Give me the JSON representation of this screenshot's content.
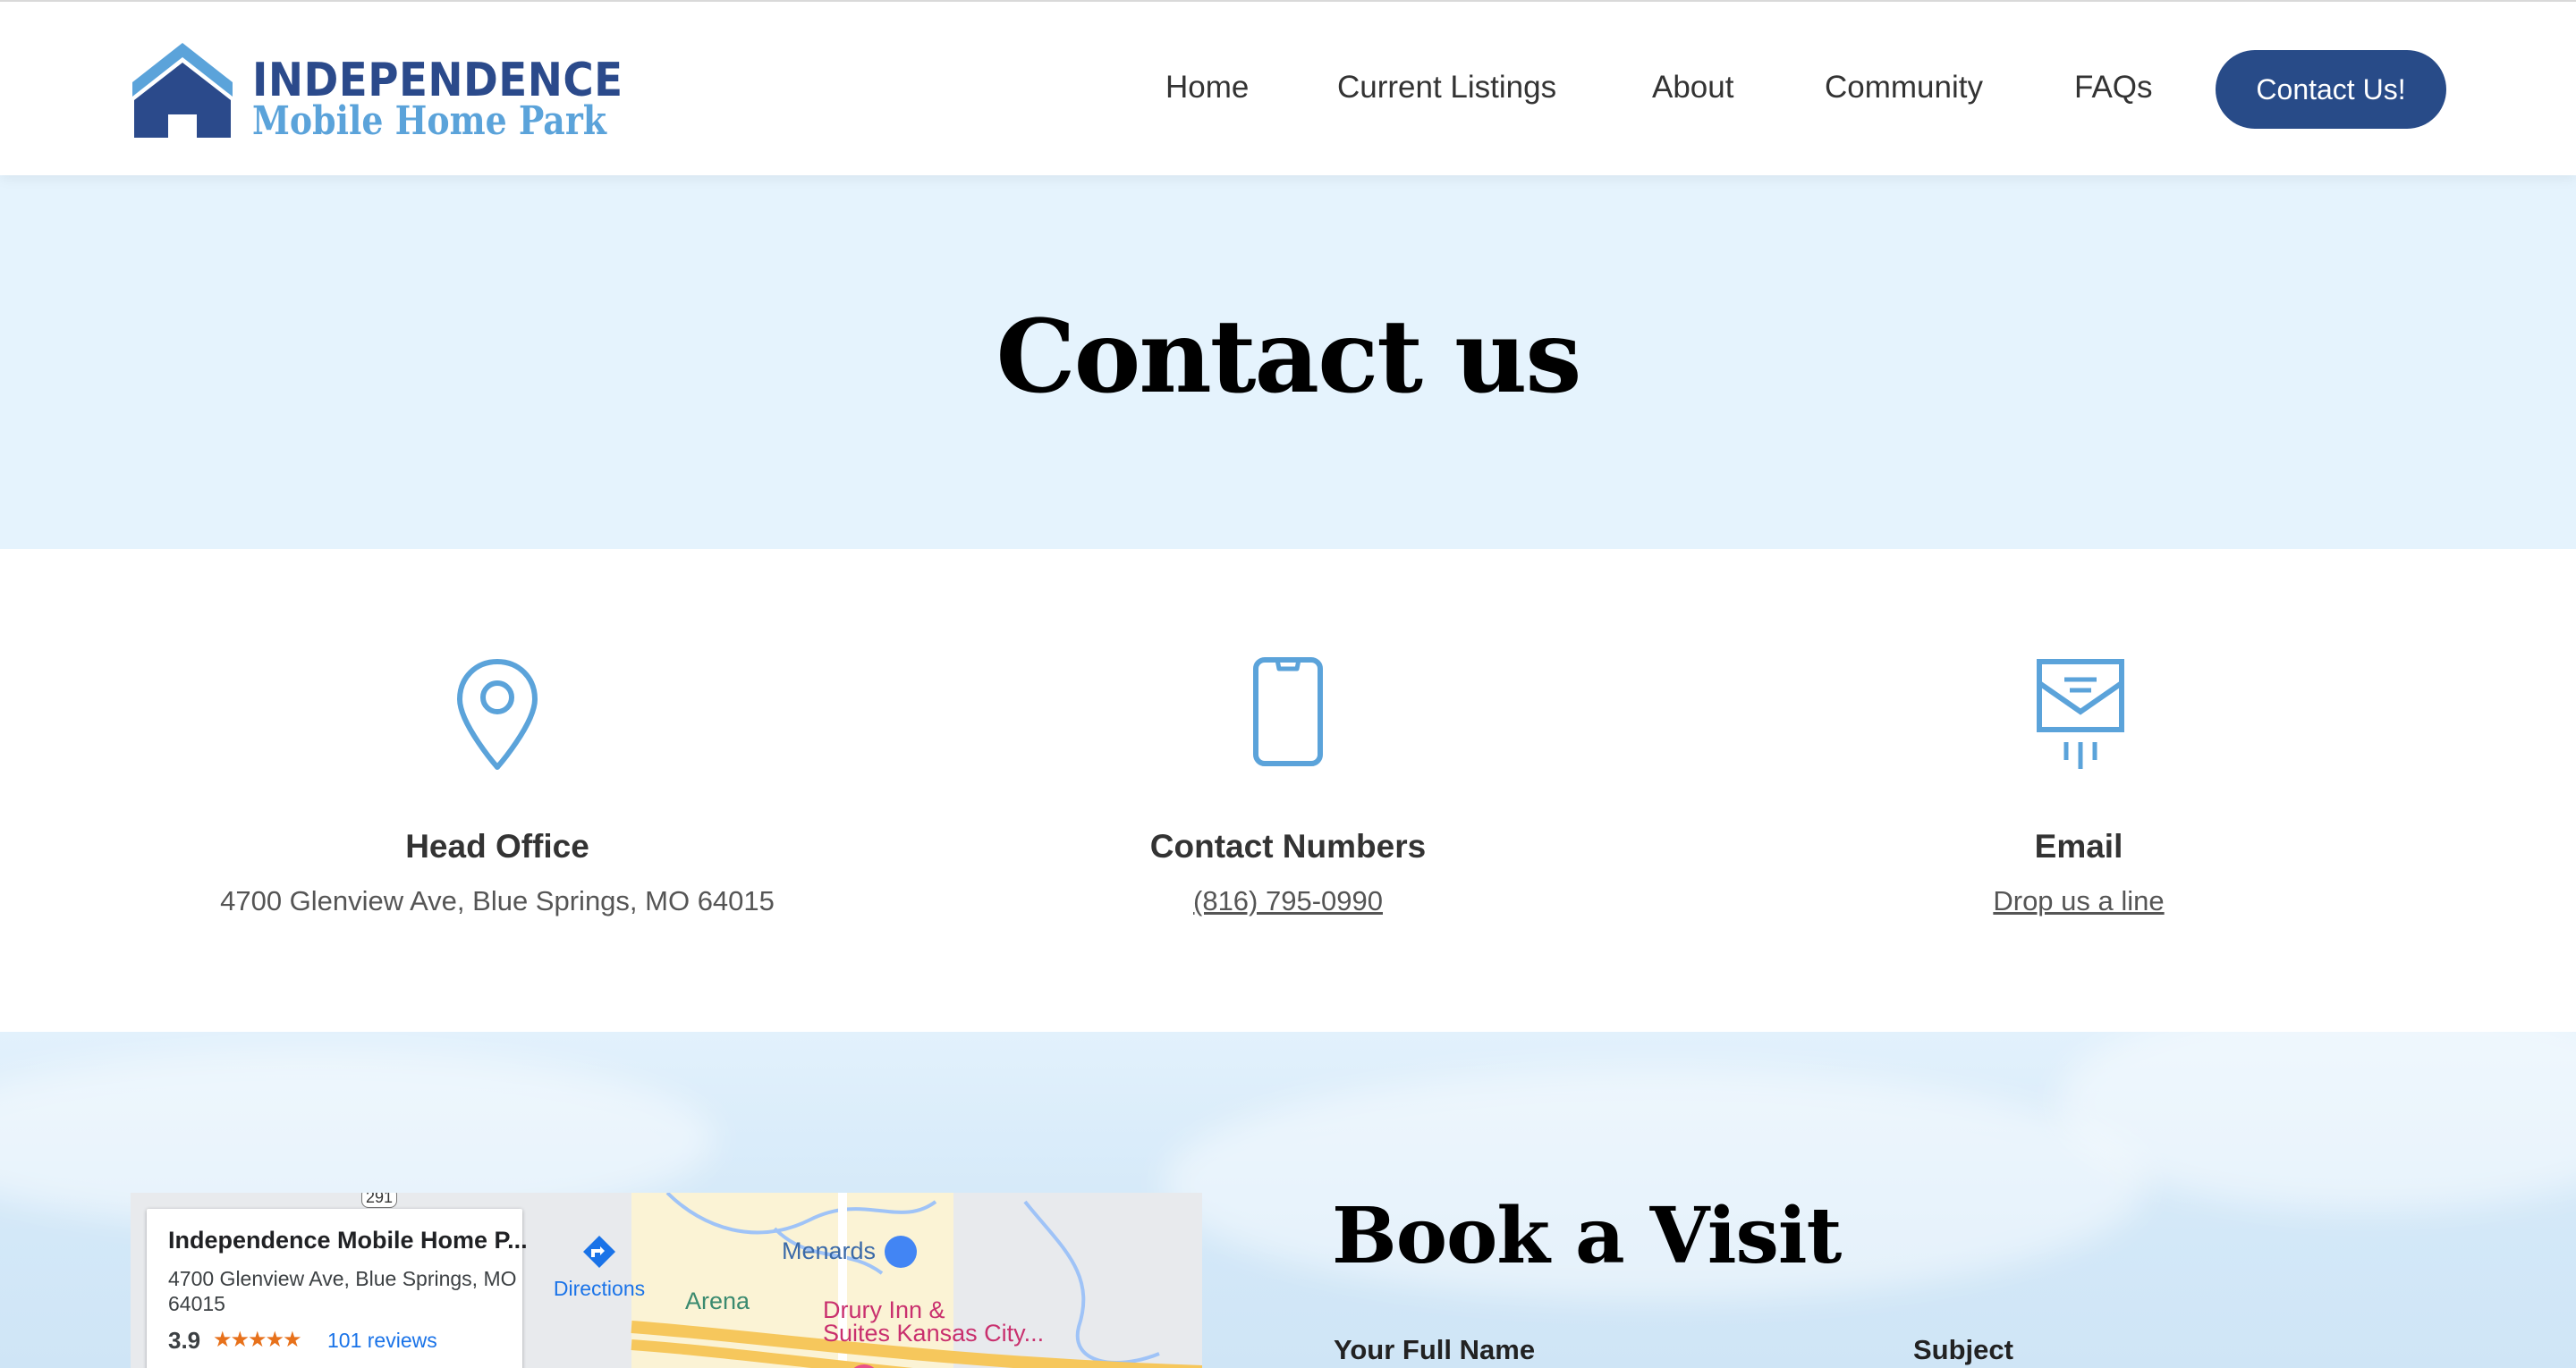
{
  "header": {
    "logo": {
      "line1": "INDEPENDENCE",
      "line2": "Mobile Home Park"
    },
    "nav": [
      "Home",
      "Current Listings",
      "About",
      "Community",
      "FAQs"
    ],
    "cta": "Contact Us!"
  },
  "hero": {
    "title": "Contact us"
  },
  "info": [
    {
      "icon": "location-pin-icon",
      "title": "Head Office",
      "text": "4700 Glenview Ave, Blue Springs, MO 64015"
    },
    {
      "icon": "smartphone-icon",
      "title": "Contact Numbers",
      "text": "(816) 795-0990"
    },
    {
      "icon": "envelope-send-icon",
      "title": "Email",
      "text": "Drop us a line"
    }
  ],
  "map": {
    "place_name": "Independence Mobile Home P...",
    "address": "4700 Glenview Ave, Blue Springs, MO 64015",
    "rating": "3.9",
    "stars": "★★★★★",
    "reviews": "101 reviews",
    "directions": "Directions",
    "labels": {
      "menards": "Menards",
      "arena": "Arena",
      "drury_line1": "Drury Inn &",
      "drury_line2": "Suites Kansas City...",
      "route": "291"
    }
  },
  "visit": {
    "title": "Book a Visit",
    "fields": {
      "name_label": "Your Full Name",
      "subject_label": "Subject"
    }
  },
  "colors": {
    "brand_dark": "#284b88",
    "brand_light": "#5ba3da",
    "hero_bg": "#e5f3fd"
  }
}
